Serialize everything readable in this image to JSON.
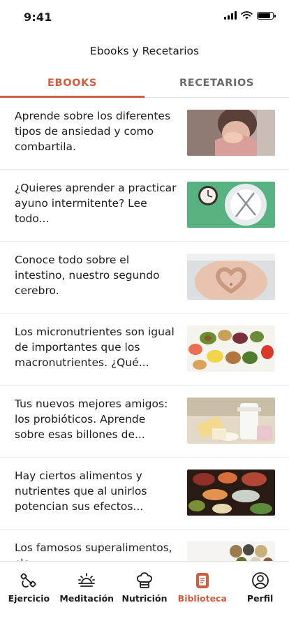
{
  "status_bar": {
    "time": "9:41"
  },
  "header": {
    "title": "Ebooks y Recetarios"
  },
  "tabs": [
    {
      "label": "EBOOKS",
      "active": true
    },
    {
      "label": "RECETARIOS",
      "active": false
    }
  ],
  "items": [
    {
      "text": "Aprende sobre los diferentes tipos de ansiedad y como combartila.",
      "image": "woman-with-anxiety-photo"
    },
    {
      "text": "¿Quieres aprender a practicar ayuno intermitente? Lee todo...",
      "image": "clock-and-plate-photo"
    },
    {
      "text": "Conoce todo sobre el intestino, nuestro segundo cerebro.",
      "image": "hands-heart-belly-photo"
    },
    {
      "text": "Los micronutrientes son igual de importantes que los macronutrientes. ¿Qué...",
      "image": "healthy-food-assortment-photo"
    },
    {
      "text": "Tus nuevos mejores amigos: los probióticos. Aprende sobre esas billones de...",
      "image": "dairy-products-photo"
    },
    {
      "text": "Hay ciertos alimentos y nutrientes que al unirlos potencian sus efectos...",
      "image": "fish-vegetables-table-photo"
    },
    {
      "text": "Los famosos superalimentos, ¿lo...",
      "image": "superfood-bowls-photo"
    }
  ],
  "bottom_nav": [
    {
      "label": "Ejercicio",
      "icon": "dumbbell-icon",
      "active": false
    },
    {
      "label": "Meditación",
      "icon": "sunrise-icon",
      "active": false
    },
    {
      "label": "Nutrición",
      "icon": "chef-hat-icon",
      "active": false
    },
    {
      "label": "Biblioteca",
      "icon": "book-icon",
      "active": true
    },
    {
      "label": "Perfil",
      "icon": "profile-icon",
      "active": false
    }
  ],
  "colors": {
    "accent": "#cf5d3f",
    "text": "#1c1c1c",
    "muted": "#6a6a6a"
  }
}
